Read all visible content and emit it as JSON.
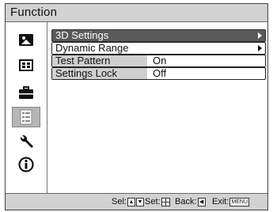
{
  "window": {
    "title": "Function"
  },
  "sidebar": {
    "items": [
      {
        "icon": "picture-icon",
        "active": false
      },
      {
        "icon": "screen-adjust-icon",
        "active": false
      },
      {
        "icon": "setup-case-icon",
        "active": false
      },
      {
        "icon": "function-list-icon",
        "active": true
      },
      {
        "icon": "wrench-icon",
        "active": false
      },
      {
        "icon": "information-icon",
        "active": false
      }
    ]
  },
  "menu": {
    "items": [
      {
        "label": "3D Settings",
        "value": "",
        "submenu": true,
        "selected": true
      },
      {
        "label": "Dynamic Range",
        "value": "",
        "submenu": true,
        "selected": false
      },
      {
        "label": "Test Pattern",
        "value": "On",
        "submenu": false,
        "selected": false
      },
      {
        "label": "Settings Lock",
        "value": "Off",
        "submenu": false,
        "selected": false
      }
    ]
  },
  "footer": {
    "sel_label": "Sel:",
    "set_label": "Set:",
    "back_label": "Back:",
    "exit_label": "Exit:",
    "exit_key": "MENU"
  }
}
